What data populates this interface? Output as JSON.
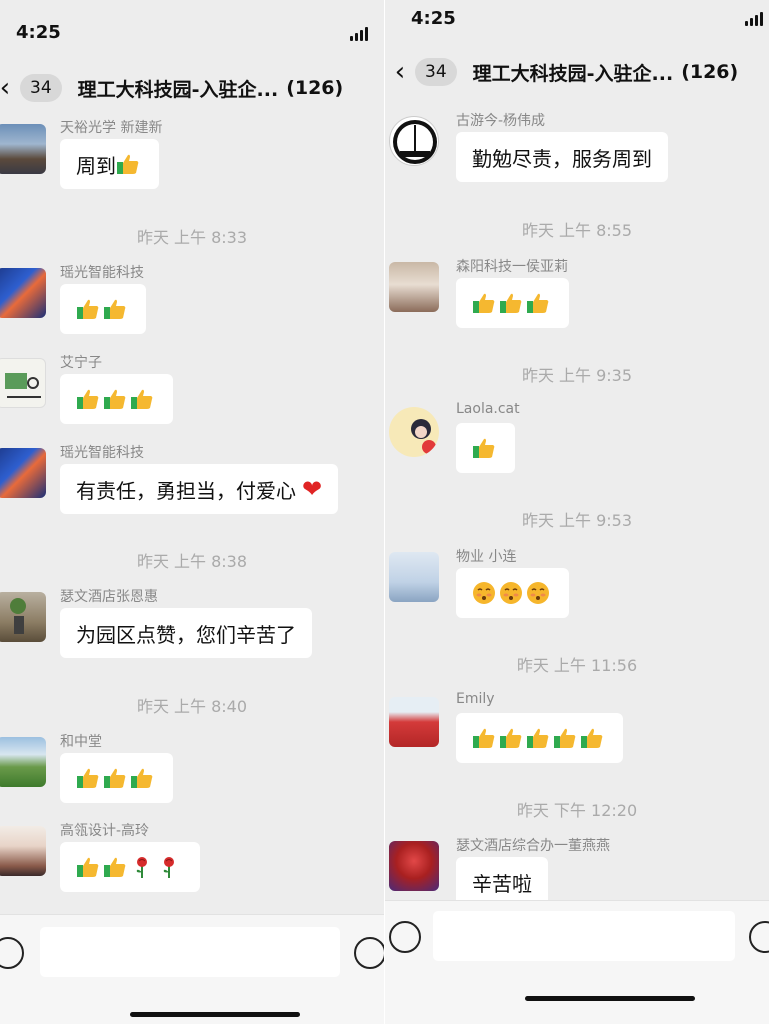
{
  "left": {
    "status": {
      "time": "4:25"
    },
    "header": {
      "back_count": "34",
      "title": "理工大科技园-入驻企...",
      "member_count": "(126)"
    },
    "items": [
      {
        "kind": "msg",
        "sender": "天裕光学 新建新",
        "text": "周到",
        "emoji": [
          "thumbs-up"
        ],
        "avatar": "landscape-avatar"
      },
      {
        "kind": "time",
        "text": "昨天 上午 8:33"
      },
      {
        "kind": "msg",
        "sender": "瑶光智能科技",
        "text": "",
        "emoji": [
          "thumbs-up",
          "thumbs-up"
        ],
        "avatar": "koi-avatar"
      },
      {
        "kind": "msg",
        "sender": "艾宁子",
        "text": "",
        "emoji": [
          "thumbs-up",
          "thumbs-up",
          "thumbs-up"
        ],
        "avatar": "doodle-avatar"
      },
      {
        "kind": "msg",
        "sender": "瑶光智能科技",
        "text": "有责任，勇担当，付爱心",
        "emoji": [
          "heart"
        ],
        "avatar": "koi-avatar"
      },
      {
        "kind": "time",
        "text": "昨天 上午 8:38"
      },
      {
        "kind": "msg",
        "sender": "瑟文酒店张恩惠",
        "text": "为园区点赞，您们辛苦了",
        "emoji": [],
        "avatar": "plant-avatar"
      },
      {
        "kind": "time",
        "text": "昨天 上午 8:40"
      },
      {
        "kind": "msg",
        "sender": "和中堂",
        "text": "",
        "emoji": [
          "thumbs-up",
          "thumbs-up",
          "thumbs-up"
        ],
        "avatar": "meadow-avatar"
      },
      {
        "kind": "msg",
        "sender": "高瓴设计-高玲",
        "text": "",
        "emoji": [
          "thumbs-up",
          "thumbs-up",
          "rose",
          "rose"
        ],
        "avatar": "woman-avatar"
      }
    ]
  },
  "right": {
    "status": {
      "time": "4:25"
    },
    "header": {
      "back_count": "34",
      "title": "理工大科技园-入驻企...",
      "member_count": "(126)"
    },
    "items": [
      {
        "kind": "msg",
        "sender": "古游今-杨伟成",
        "text": "勤勉尽责，服务周到",
        "emoji": [],
        "avatar": "tower-logo-avatar"
      },
      {
        "kind": "time",
        "text": "昨天 上午 8:55"
      },
      {
        "kind": "msg",
        "sender": "森阳科技一侯亚莉",
        "text": "",
        "emoji": [
          "thumbs-up",
          "thumbs-up",
          "thumbs-up"
        ],
        "avatar": "hat-woman-avatar"
      },
      {
        "kind": "time",
        "text": "昨天 上午 9:35"
      },
      {
        "kind": "msg",
        "sender": "Laola.cat",
        "text": "",
        "emoji": [
          "thumbs-up"
        ],
        "avatar": "cartoon-avatar"
      },
      {
        "kind": "time",
        "text": "昨天 上午 9:53"
      },
      {
        "kind": "msg",
        "sender": "物业   小连",
        "text": "",
        "emoji": [
          "shy-face",
          "shy-face",
          "shy-face"
        ],
        "avatar": "family-avatar"
      },
      {
        "kind": "time",
        "text": "昨天 上午 11:56"
      },
      {
        "kind": "msg",
        "sender": "Emily",
        "text": "",
        "emoji": [
          "thumbs-up",
          "thumbs-up",
          "thumbs-up",
          "thumbs-up",
          "thumbs-up"
        ],
        "avatar": "baby-avatar"
      },
      {
        "kind": "time",
        "text": "昨天 下午 12:20"
      },
      {
        "kind": "msg",
        "sender": "瑟文酒店综合办一董燕燕",
        "text": "辛苦啦",
        "emoji": [],
        "avatar": "roses-avatar"
      }
    ]
  },
  "colors": {
    "background": "#ededed",
    "bubble": "#ffffff",
    "thumb": "#f5b830",
    "sleeve": "#2faa4f"
  }
}
